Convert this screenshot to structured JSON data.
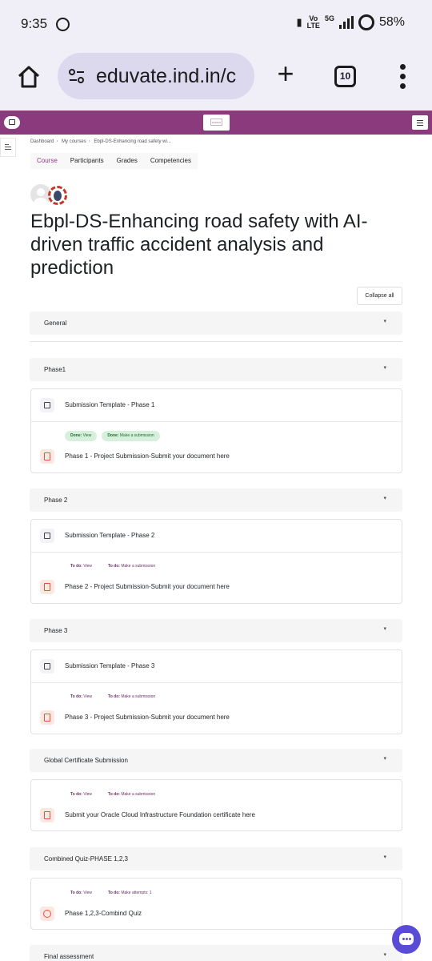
{
  "status_bar": {
    "time": "9:35",
    "volte_top": "Vo",
    "volte_bottom": "LTE",
    "network": "5G",
    "battery": "58%"
  },
  "browser": {
    "url": "eduvate.ind.in/c",
    "tab_count": "10"
  },
  "breadcrumb": [
    "Dashboard",
    "My courses",
    "Ebpl-DS-Enhancing road safety wi..."
  ],
  "course_tabs": [
    "Course",
    "Participants",
    "Grades",
    "Competencies"
  ],
  "course_title": "Ebpl-DS-Enhancing road safety with AI-driven traffic accident analysis and prediction",
  "collapse_all": "Collapse all",
  "sections": {
    "general": "General",
    "phase1": "Phase1",
    "phase2": "Phase 2",
    "phase3": "Phase 3",
    "global_cert": "Global Certificate Submission",
    "combined_quiz": "Combined Quiz-PHASE 1,2,3",
    "final": "Final assessment"
  },
  "activities": {
    "tpl1": "Submission Template - Phase 1",
    "p1_done_view_k": "Done:",
    "p1_done_view_v": "View",
    "p1_done_sub_k": "Done:",
    "p1_done_sub_v": "Make a submission",
    "sub1": "Phase 1 - Project Submission-Submit your document here",
    "tpl2": "Submission Template - Phase 2",
    "p2_todo_view_k": "To do:",
    "p2_todo_view_v": "View",
    "p2_todo_sub_k": "To do:",
    "p2_todo_sub_v": "Make a submission",
    "sub2": "Phase 2 - Project Submission-Submit your document here",
    "tpl3": "Submission Template - Phase 3",
    "p3_todo_view_k": "To do:",
    "p3_todo_view_v": "View",
    "p3_todo_sub_k": "To do:",
    "p3_todo_sub_v": "Make a submission",
    "sub3": "Phase 3 - Project Submission-Submit your document here",
    "gc_todo_view_k": "To do:",
    "gc_todo_view_v": "View",
    "gc_todo_sub_k": "To do:",
    "gc_todo_sub_v": "Make a submission",
    "gc_sub": "Submit your Oracle Cloud Infrastructure Foundation certificate here",
    "q_todo_view_k": "To do:",
    "q_todo_view_v": "View",
    "q_todo_att_k": "To do:",
    "q_todo_att_v": "Make attempts: 1",
    "quiz": "Phase 1,2,3-Combind Quiz"
  }
}
